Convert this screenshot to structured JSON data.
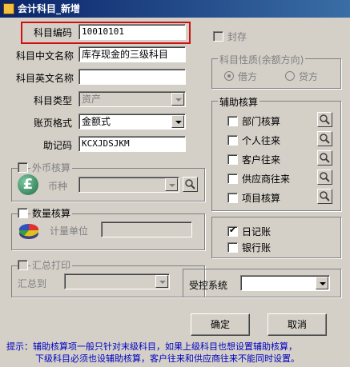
{
  "window": {
    "title": "会计科目_新增"
  },
  "fields": {
    "code_label": "科目编码",
    "code_value": "10010101",
    "cn_name_label": "科目中文名称",
    "cn_name_value": "库存现金的三级科目",
    "en_name_label": "科目英文名称",
    "en_name_value": "",
    "type_label": "科目类型",
    "type_value": "资产",
    "format_label": "账页格式",
    "format_value": "金额式",
    "mnemonic_label": "助记码",
    "mnemonic_value": "KCXJDSJKM"
  },
  "seal": {
    "label": "封存",
    "checked": false
  },
  "nature": {
    "title": "科目性质(余额方向)",
    "debit": "借方",
    "credit": "贷方",
    "selected": "借方"
  },
  "aux": {
    "title": "辅助核算",
    "items": [
      {
        "label": "部门核算",
        "checked": false
      },
      {
        "label": "个人往来",
        "checked": false
      },
      {
        "label": "客户往来",
        "checked": false
      },
      {
        "label": "供应商往来",
        "checked": false
      },
      {
        "label": "项目核算",
        "checked": false
      }
    ]
  },
  "foreign": {
    "title": "外币核算",
    "currency_label": "币种",
    "currency_value": ""
  },
  "quantity": {
    "title": "数量核算",
    "unit_label": "计量单位",
    "unit_value": ""
  },
  "journal": {
    "daily": "日记账",
    "daily_checked": true,
    "bank": "银行账",
    "bank_checked": false
  },
  "summary": {
    "title": "汇总打印",
    "to_label": "汇总到",
    "to_value": ""
  },
  "controlled": {
    "label": "受控系统",
    "value": ""
  },
  "buttons": {
    "ok": "确定",
    "cancel": "取消"
  },
  "hint": {
    "line1": "提示：辅助核算项一般只针对末级科目，如果上级科目也想设置辅助核算，",
    "line2": "下级科目必须也设辅助核算，客户往来和供应商往来不能同时设置。"
  },
  "colors": {
    "title_bar": "#0a246a",
    "highlight_box": "#d01010",
    "hint_text": "#0000c0",
    "face": "#d4d0c8"
  },
  "icons": [
    "window-icon",
    "currency-pound-icon",
    "pie-chart-icon",
    "magnifier-icon"
  ]
}
